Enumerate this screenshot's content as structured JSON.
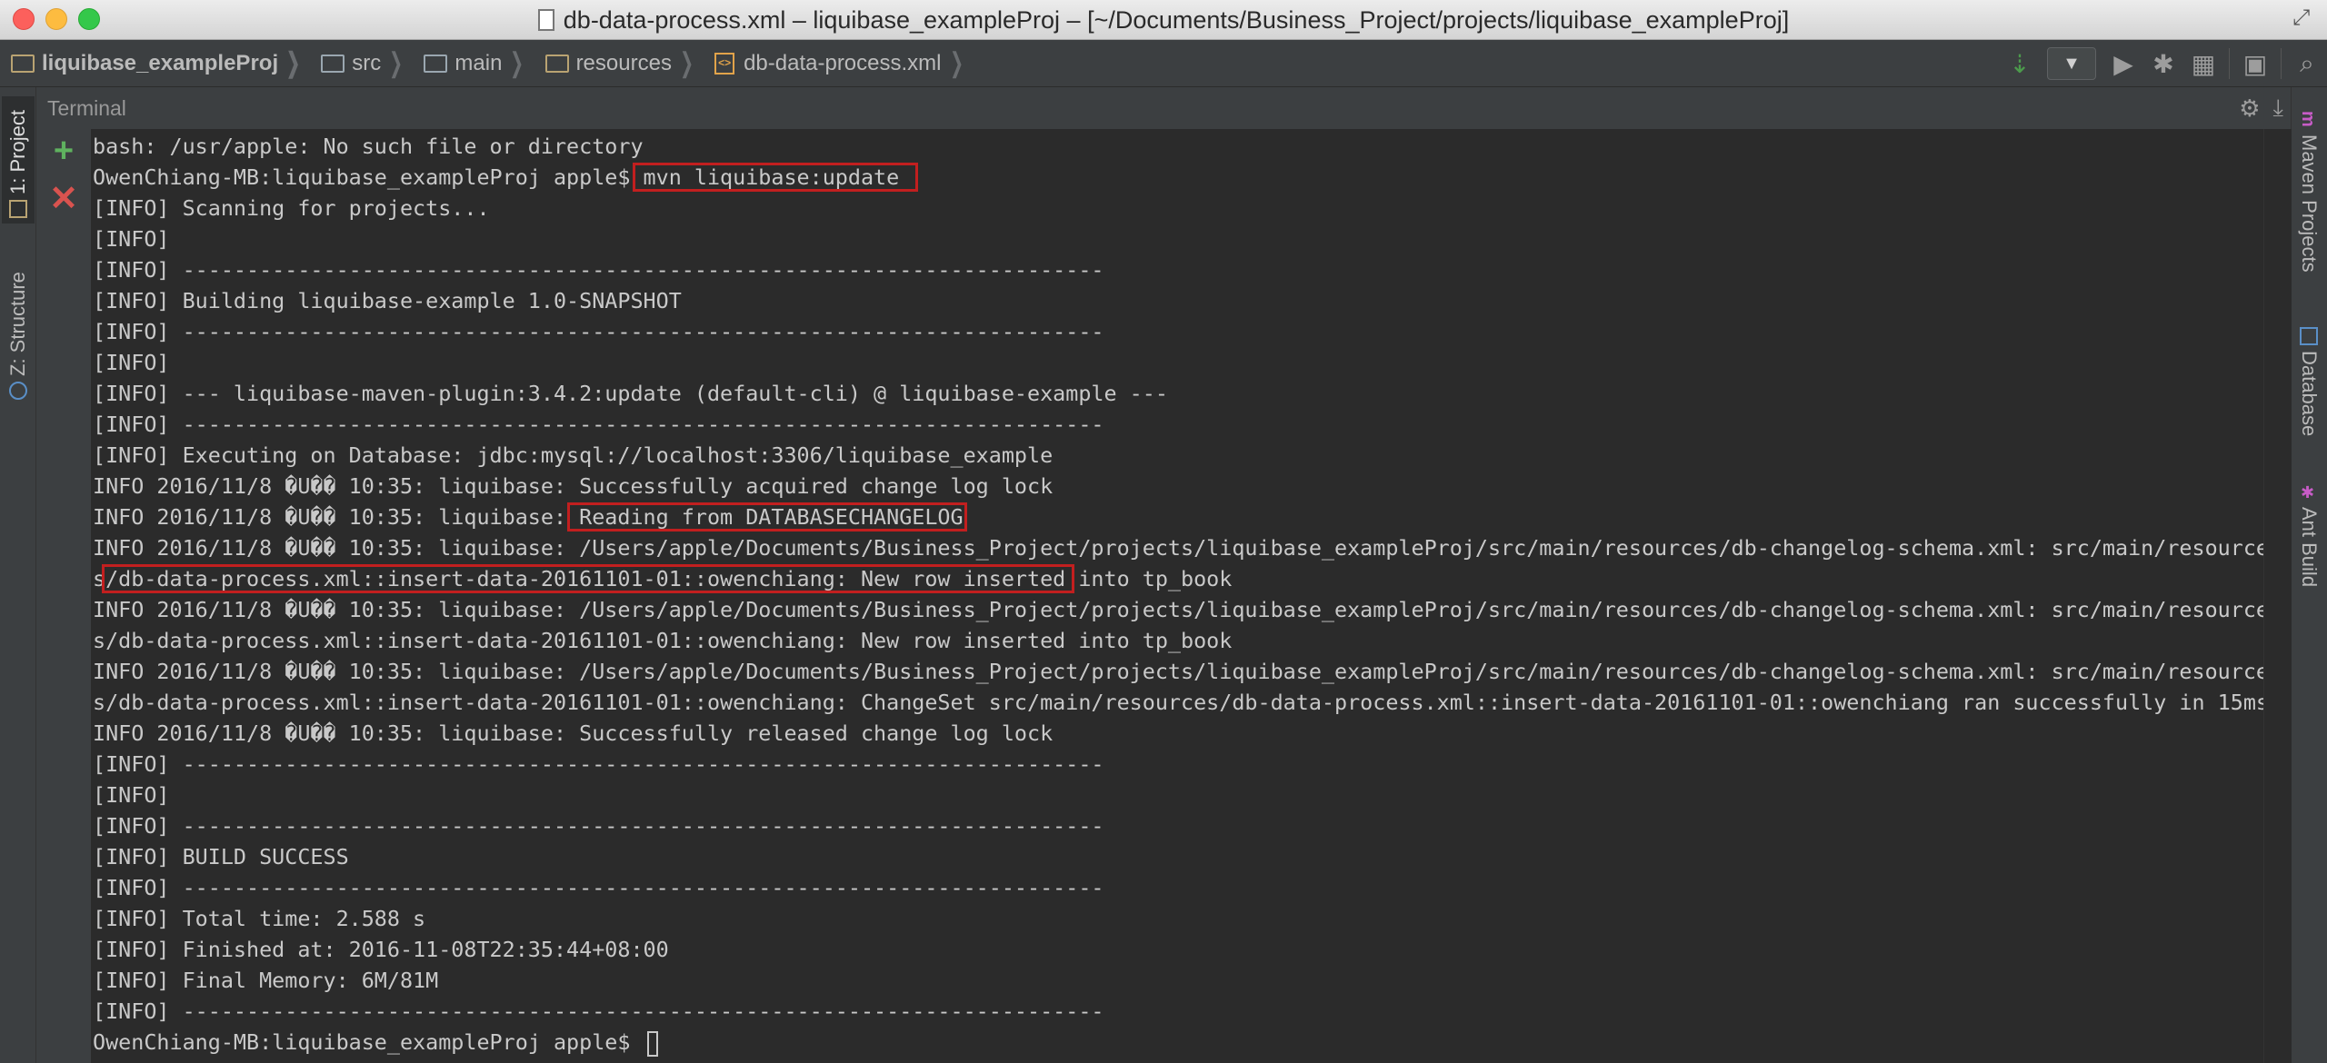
{
  "window": {
    "title": "db-data-process.xml – liquibase_exampleProj – [~/Documents/Business_Project/projects/liquibase_exampleProj]"
  },
  "breadcrumbs": [
    {
      "label": "liquibase_exampleProj",
      "icon": "project-folder-icon"
    },
    {
      "label": "src",
      "icon": "folder-icon"
    },
    {
      "label": "main",
      "icon": "folder-icon"
    },
    {
      "label": "resources",
      "icon": "resources-folder-icon"
    },
    {
      "label": "db-data-process.xml",
      "icon": "xml-file-icon"
    }
  ],
  "left_stripe": {
    "project_tab": "1: Project",
    "structure_tab": "Z: Structure"
  },
  "right_stripe": {
    "maven_tab": "Maven Projects",
    "database_tab": "Database",
    "ant_tab": "Ant Build"
  },
  "terminal": {
    "title": "Terminal",
    "lines": [
      "bash: /usr/apple: No such file or directory",
      "OwenChiang-MB:liquibase_exampleProj apple$ mvn liquibase:update",
      "[INFO] Scanning for projects...",
      "[INFO]",
      "[INFO] ------------------------------------------------------------------------",
      "[INFO] Building liquibase-example 1.0-SNAPSHOT",
      "[INFO] ------------------------------------------------------------------------",
      "[INFO]",
      "[INFO] --- liquibase-maven-plugin:3.4.2:update (default-cli) @ liquibase-example ---",
      "[INFO] ------------------------------------------------------------------------",
      "[INFO] Executing on Database: jdbc:mysql://localhost:3306/liquibase_example",
      "INFO 2016/11/8 �U�� 10:35: liquibase: Successfully acquired change log lock",
      "INFO 2016/11/8 �U�� 10:35: liquibase: Reading from DATABASECHANGELOG",
      "INFO 2016/11/8 �U�� 10:35: liquibase: /Users/apple/Documents/Business_Project/projects/liquibase_exampleProj/src/main/resources/db-changelog-schema.xml: src/main/resource",
      "s/db-data-process.xml::insert-data-20161101-01::owenchiang: New row inserted into tp_book",
      "INFO 2016/11/8 �U�� 10:35: liquibase: /Users/apple/Documents/Business_Project/projects/liquibase_exampleProj/src/main/resources/db-changelog-schema.xml: src/main/resource",
      "s/db-data-process.xml::insert-data-20161101-01::owenchiang: New row inserted into tp_book",
      "INFO 2016/11/8 �U�� 10:35: liquibase: /Users/apple/Documents/Business_Project/projects/liquibase_exampleProj/src/main/resources/db-changelog-schema.xml: src/main/resource",
      "s/db-data-process.xml::insert-data-20161101-01::owenchiang: ChangeSet src/main/resources/db-data-process.xml::insert-data-20161101-01::owenchiang ran successfully in 15ms",
      "INFO 2016/11/8 �U�� 10:35: liquibase: Successfully released change log lock",
      "[INFO] ------------------------------------------------------------------------",
      "[INFO]",
      "[INFO] ------------------------------------------------------------------------",
      "[INFO] BUILD SUCCESS",
      "[INFO] ------------------------------------------------------------------------",
      "[INFO] Total time: 2.588 s",
      "[INFO] Finished at: 2016-11-08T22:35:44+08:00",
      "[INFO] Final Memory: 6M/81M",
      "[INFO] ------------------------------------------------------------------------",
      "OwenChiang-MB:liquibase_exampleProj apple$ "
    ]
  },
  "colors": {
    "highlight_box": "#c21f1f",
    "terminal_bg": "#2b2b2b",
    "terminal_text": "#c9c9c9"
  }
}
